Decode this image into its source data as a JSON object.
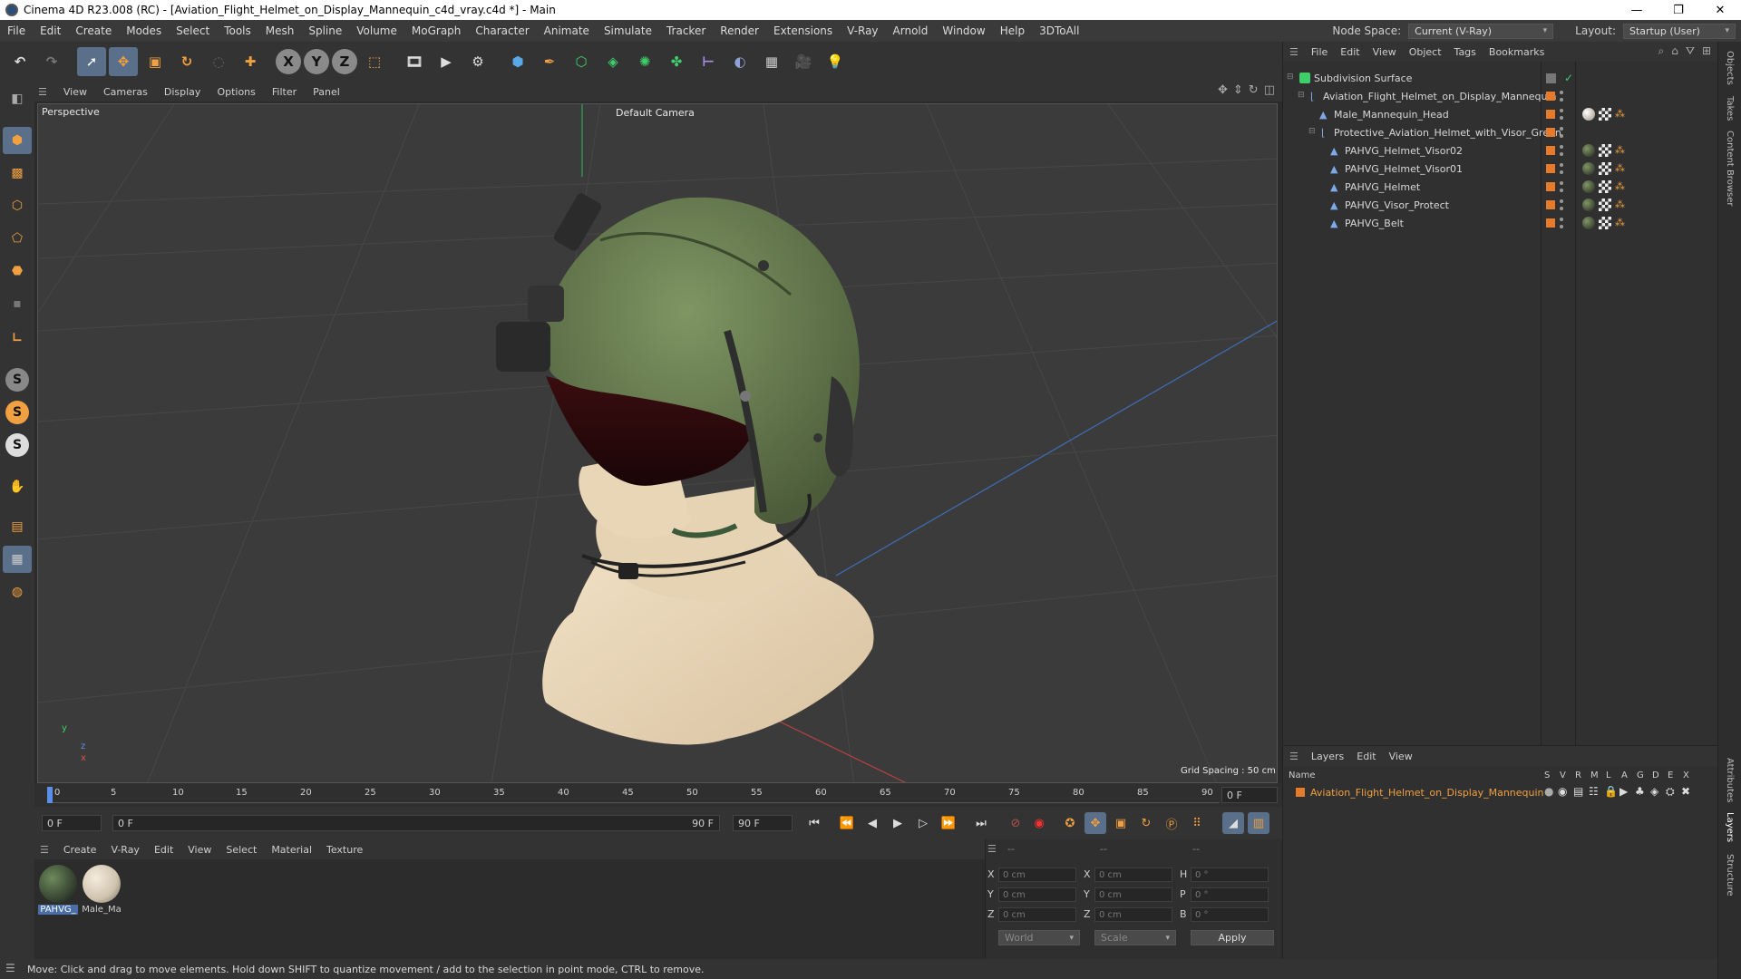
{
  "window": {
    "title": "Cinema 4D R23.008 (RC) - [Aviation_Flight_Helmet_on_Display_Mannequin_c4d_vray.c4d *] - Main",
    "controls": [
      "—",
      "❐",
      "✕"
    ]
  },
  "menubar": {
    "items": [
      "File",
      "Edit",
      "Create",
      "Modes",
      "Select",
      "Tools",
      "Mesh",
      "Spline",
      "Volume",
      "MoGraph",
      "Character",
      "Animate",
      "Simulate",
      "Tracker",
      "Render",
      "Extensions",
      "V-Ray",
      "Arnold",
      "Window",
      "Help",
      "3DToAll"
    ],
    "node_space_label": "Node Space:",
    "node_space_value": "Current (V-Ray)",
    "layout_label": "Layout:",
    "layout_value": "Startup (User)"
  },
  "toolbar": {
    "axis_x": "X",
    "axis_y": "Y",
    "axis_z": "Z"
  },
  "viewport": {
    "menu": [
      "View",
      "Cameras",
      "Display",
      "Options",
      "Filter",
      "Panel"
    ],
    "projection": "Perspective",
    "camera": "Default Camera",
    "grid_spacing": "Grid Spacing : 50 cm",
    "axis_y": "y",
    "axis_z": "z",
    "axis_x": "x"
  },
  "timeline": {
    "ticks": [
      "0",
      "5",
      "10",
      "15",
      "20",
      "25",
      "30",
      "35",
      "40",
      "45",
      "50",
      "55",
      "60",
      "65",
      "70",
      "75",
      "80",
      "85",
      "90"
    ],
    "current_frame": "0 F",
    "start_field": "0 F",
    "range_start": "0 F",
    "range_end": "90 F",
    "end_field": "90 F"
  },
  "material_manager": {
    "menu": [
      "Create",
      "V-Ray",
      "Edit",
      "View",
      "Select",
      "Material",
      "Texture"
    ],
    "materials": [
      {
        "label": "PAHVG_",
        "color": "#2f3a2c"
      },
      {
        "label": "Male_Ma",
        "color": "#cfc3ae"
      }
    ]
  },
  "coordinates": {
    "header": [
      "--",
      "--",
      "--"
    ],
    "rows": [
      {
        "a": "X",
        "av": "0 cm",
        "b": "X",
        "bv": "0 cm",
        "c": "H",
        "cv": "0 °"
      },
      {
        "a": "Y",
        "av": "0 cm",
        "b": "Y",
        "bv": "0 cm",
        "c": "P",
        "cv": "0 °"
      },
      {
        "a": "Z",
        "av": "0 cm",
        "b": "Z",
        "bv": "0 cm",
        "c": "B",
        "cv": "0 °"
      }
    ],
    "mode": "World",
    "type": "Scale",
    "apply": "Apply"
  },
  "status": "Move: Click and drag to move elements. Hold down SHIFT to quantize movement / add to the selection in point mode, CTRL to remove.",
  "objects": {
    "menu": [
      "File",
      "Edit",
      "View",
      "Object",
      "Tags",
      "Bookmarks"
    ],
    "items": [
      {
        "name": "Subdivision Surface",
        "indent": 0
      },
      {
        "name": "Aviation_Flight_Helmet_on_Display_Mannequin",
        "indent": 1
      },
      {
        "name": "Male_Mannequin_Head",
        "indent": 2
      },
      {
        "name": "Protective_Aviation_Helmet_with_Visor_Green",
        "indent": 2
      },
      {
        "name": "PAHVG_Helmet_Visor02",
        "indent": 3
      },
      {
        "name": "PAHVG_Helmet_Visor01",
        "indent": 3
      },
      {
        "name": "PAHVG_Helmet",
        "indent": 3
      },
      {
        "name": "PAHVG_Visor_Protect",
        "indent": 3
      },
      {
        "name": "PAHVG_Belt",
        "indent": 3
      }
    ]
  },
  "layers": {
    "menu": [
      "Layers",
      "Edit",
      "View"
    ],
    "col_name": "Name",
    "cols": [
      "S",
      "V",
      "R",
      "M",
      "L",
      "A",
      "G",
      "D",
      "E",
      "X"
    ],
    "item": "Aviation_Flight_Helmet_on_Display_Mannequin"
  },
  "right_tabs": [
    "Objects",
    "Takes",
    "Content Browser",
    "Attributes",
    "Layers",
    "Structure"
  ]
}
